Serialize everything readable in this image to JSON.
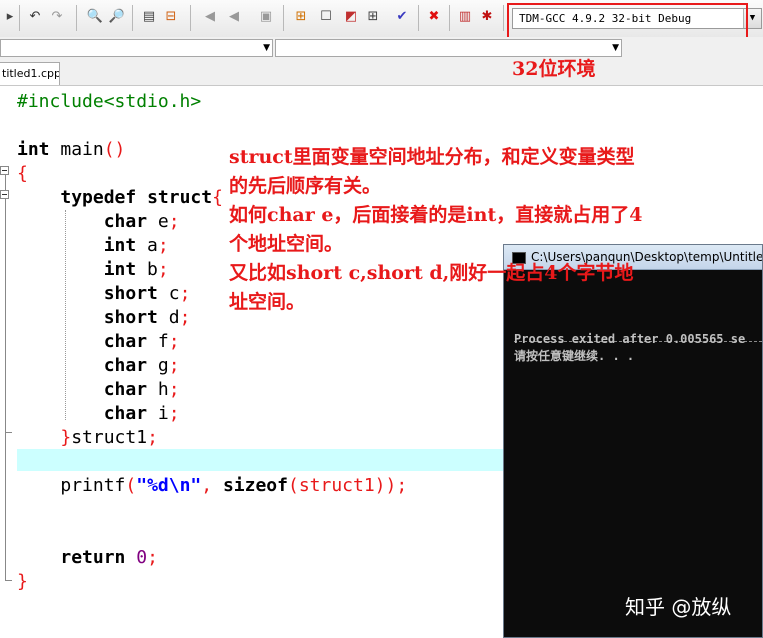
{
  "toolbar": {
    "icons": [
      "undo-icon",
      "redo-icon",
      "find-icon",
      "replace-icon",
      "compile-icon",
      "toggle-icon",
      "indent-icon",
      "unindent-icon",
      "comment-icon",
      "bookmark-icon",
      "layout-icon",
      "window-icon",
      "color-icon",
      "grid-icon",
      "check-icon",
      "close-icon",
      "chart-icon",
      "debug-icon"
    ],
    "compiler": "TDM-GCC 4.9.2 32-bit Debug"
  },
  "annotation": {
    "environment": "32位环境",
    "lines": [
      "struct里面变量空间地址分布，和定义变量类型",
      "的先后顺序有关。",
      "如何char e，后面接着的是int，直接就占用了4",
      "个地址空间。",
      "又比如short c,short d,刚好一起占4个字节地",
      "址空间。"
    ]
  },
  "editor": {
    "tab": "titled1.cpp",
    "code": {
      "line1": "#include<stdio.h>",
      "int_kw": "int",
      "main": " main",
      "paren": "()",
      "brace_open": "{",
      "typedef_kw": "typedef",
      "struct_kw": "struct",
      "brace_inner": "{",
      "members": [
        {
          "type": "char",
          "name": " e"
        },
        {
          "type": "int",
          "name": " a"
        },
        {
          "type": "int",
          "name": " b"
        },
        {
          "type": "short",
          "name": " c"
        },
        {
          "type": "short",
          "name": " d"
        },
        {
          "type": "char",
          "name": " f"
        },
        {
          "type": "char",
          "name": " g"
        },
        {
          "type": "char",
          "name": " h"
        },
        {
          "type": "char",
          "name": " i"
        }
      ],
      "semicolon": ";",
      "close_struct": "}",
      "struct_name": "struct1",
      "printf": "printf",
      "format": "\"%d\\n\"",
      "comma": ", ",
      "sizeof_kw": "sizeof",
      "sizeof_arg": "(struct1)",
      "printf_end": ");",
      "return_kw": "return",
      "zero": "0",
      "brace_close": "}"
    }
  },
  "console": {
    "title": "C:\\Users\\panqun\\Desktop\\temp\\Untitle",
    "output1": "Process exited after 0.005565 se",
    "output2": "请按任意键继续. . ."
  },
  "watermark": "知乎 @放纵",
  "colors": {
    "annotation": "#e8191a",
    "highlight_line": "#ccffff",
    "console_bg": "#0c0c0c"
  }
}
